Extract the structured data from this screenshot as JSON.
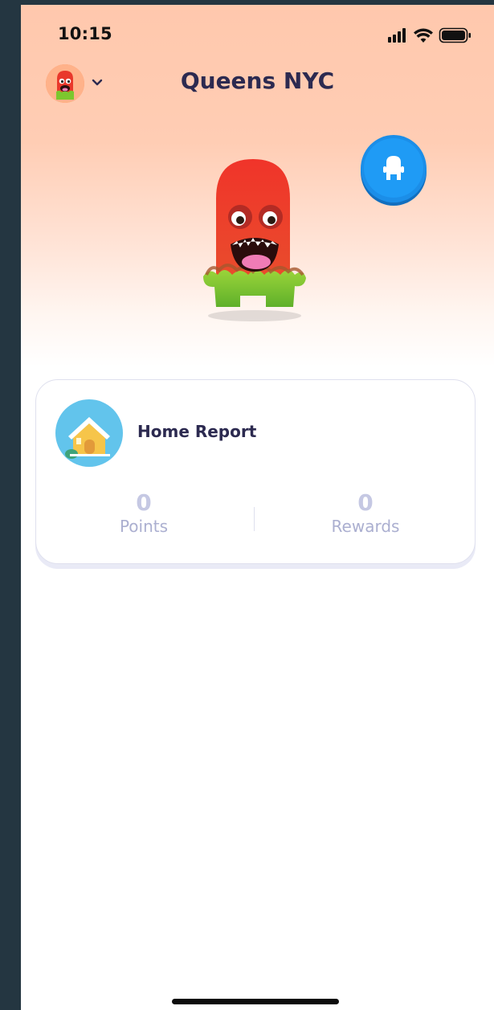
{
  "status_bar": {
    "time": "10:15",
    "icons": [
      "cellular-signal-icon",
      "wifi-icon",
      "battery-icon"
    ]
  },
  "header": {
    "title": "Queens NYC",
    "avatar": "monster-avatar",
    "dropdown_icon": "chevron-down-icon"
  },
  "hero": {
    "monster": "red-monster-illustration",
    "customize_button_icon": "monster-figure-icon"
  },
  "report_card": {
    "icon": "house-icon",
    "title": "Home Report",
    "points_value": "0",
    "points_label": "Points",
    "rewards_value": "0",
    "rewards_label": "Rewards"
  },
  "colors": {
    "header_gradient_top": "#ffc8ad",
    "title_text": "#2c2a50",
    "accent_blue": "#1f9bf5",
    "stat_text": "#abafd0"
  }
}
